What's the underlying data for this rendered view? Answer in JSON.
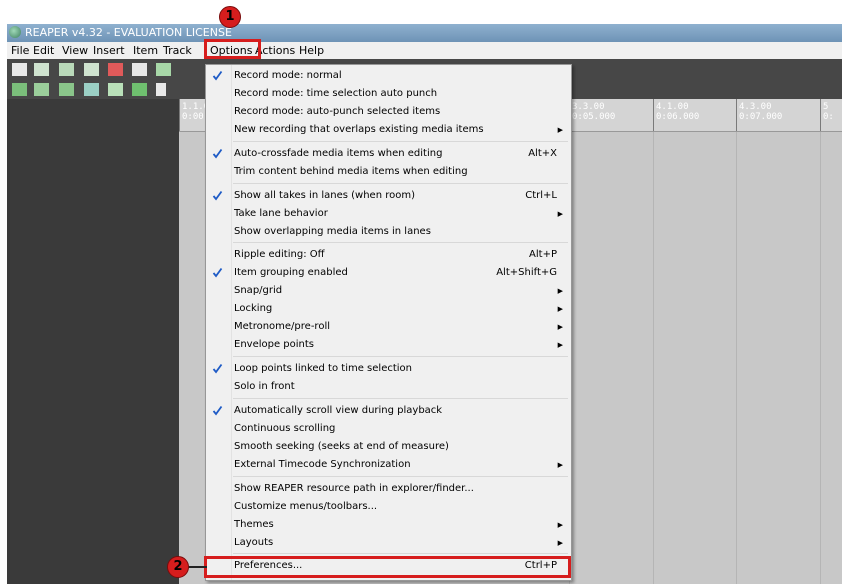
{
  "window": {
    "title": "REAPER v4.32 - EVALUATION LICENSE"
  },
  "menubar": [
    "File",
    "Edit",
    "View",
    "Insert",
    "Item",
    "Track",
    "Options",
    "Actions",
    "Help"
  ],
  "ruler": [
    {
      "bar": "1.1.0",
      "time": "0:00."
    },
    {
      "bar": "3.3.00",
      "time": "0:05.000"
    },
    {
      "bar": "4.1.00",
      "time": "0:06.000"
    },
    {
      "bar": "4.3.00",
      "time": "0:07.000"
    },
    {
      "bar": "5",
      "time": "0:"
    }
  ],
  "options_menu": [
    {
      "label": "Record mode: normal",
      "checked": true
    },
    {
      "label": "Record mode: time selection auto punch"
    },
    {
      "label": "Record mode: auto-punch selected items"
    },
    {
      "label": "New recording that overlaps existing media items",
      "submenu": true
    },
    {
      "label": "Auto-crossfade media items when editing",
      "checked": true,
      "shortcut": "Alt+X"
    },
    {
      "label": "Trim content behind media items when editing"
    },
    {
      "label": "Show all takes in lanes (when room)",
      "checked": true,
      "shortcut": "Ctrl+L"
    },
    {
      "label": "Take lane behavior",
      "submenu": true
    },
    {
      "label": "Show overlapping media items in lanes"
    },
    {
      "label": "Ripple editing: Off",
      "shortcut": "Alt+P"
    },
    {
      "label": "Item grouping enabled",
      "checked": true,
      "shortcut": "Alt+Shift+G"
    },
    {
      "label": "Snap/grid",
      "submenu": true
    },
    {
      "label": "Locking",
      "submenu": true
    },
    {
      "label": "Metronome/pre-roll",
      "submenu": true
    },
    {
      "label": "Envelope points",
      "submenu": true
    },
    {
      "label": "Loop points linked to time selection",
      "checked": true
    },
    {
      "label": "Solo in front"
    },
    {
      "label": "Automatically scroll view during playback",
      "checked": true
    },
    {
      "label": "Continuous scrolling"
    },
    {
      "label": "Smooth seeking (seeks at end of measure)"
    },
    {
      "label": "External Timecode Synchronization",
      "submenu": true
    },
    {
      "label": "Show REAPER resource path in explorer/finder..."
    },
    {
      "label": "Customize menus/toolbars..."
    },
    {
      "label": "Themes",
      "submenu": true
    },
    {
      "label": "Layouts",
      "submenu": true
    },
    {
      "label": "Preferences...",
      "shortcut": "Ctrl+P"
    }
  ],
  "annotations": {
    "badge1": "1",
    "badge2": "2"
  },
  "colors": {
    "highlight": "#d61d1d",
    "menu_bg": "#f0f0f0",
    "check": "#1e5bc6"
  }
}
